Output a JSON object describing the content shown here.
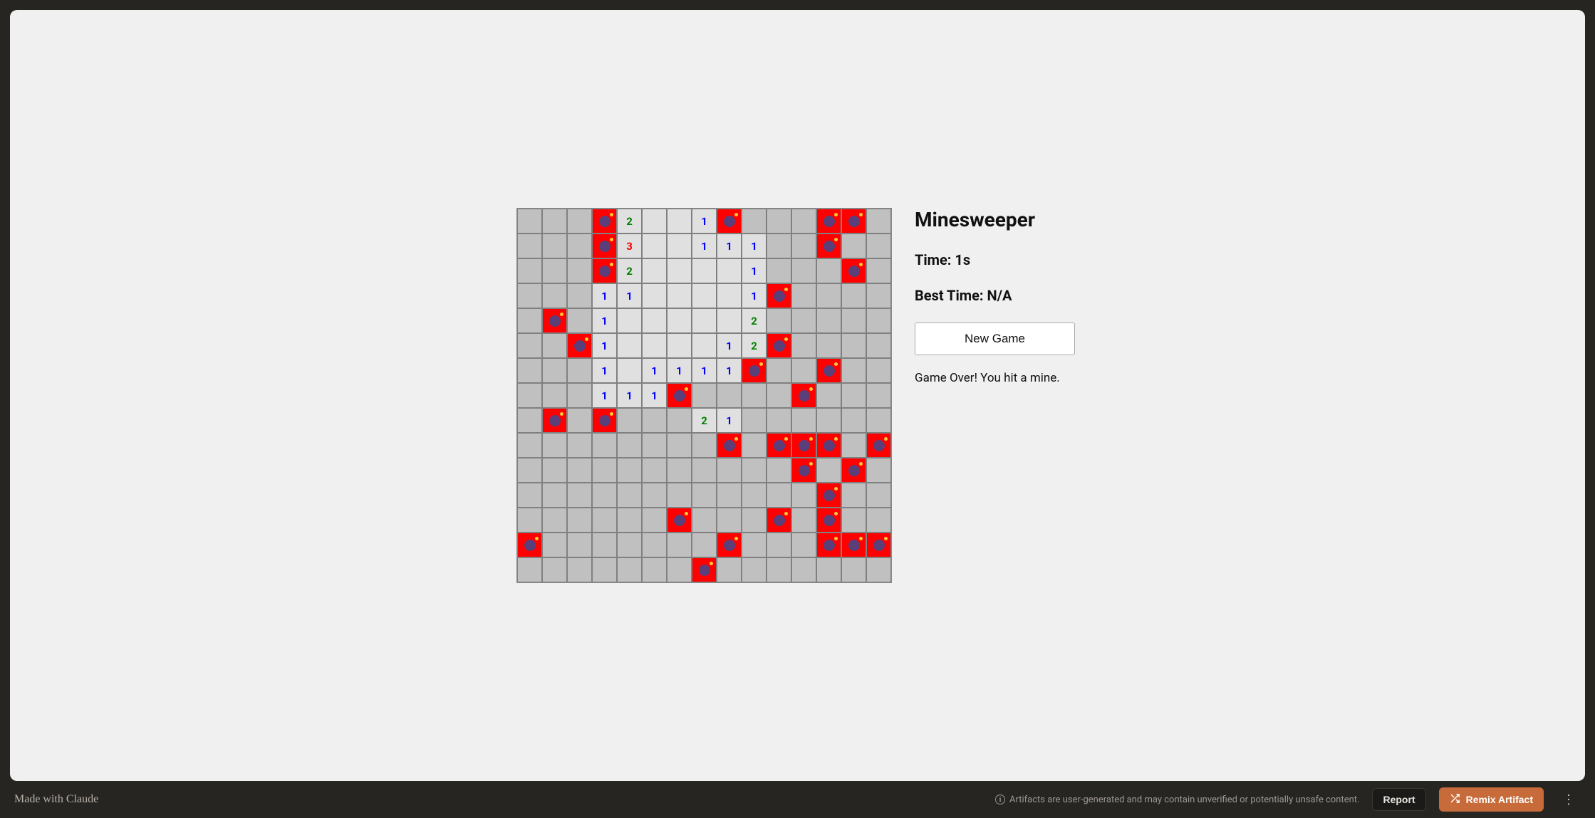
{
  "game": {
    "title": "Minesweeper",
    "time_label": "Time: ",
    "time_value": "1s",
    "best_label": "Best Time: ",
    "best_value": "N/A",
    "new_game_label": "New Game",
    "status_message": "Game Over! You hit a mine.",
    "grid_size": 15,
    "cells": [
      [
        "c",
        "c",
        "c",
        "m",
        "2",
        "o",
        "o",
        "1",
        "m",
        "c",
        "c",
        "c",
        "m",
        "m",
        "c"
      ],
      [
        "c",
        "c",
        "c",
        "m",
        "3",
        "o",
        "o",
        "1",
        "1",
        "1",
        "c",
        "c",
        "m",
        "c",
        "c"
      ],
      [
        "c",
        "c",
        "c",
        "m",
        "2",
        "o",
        "o",
        "o",
        "o",
        "1",
        "c",
        "c",
        "c",
        "m",
        "c"
      ],
      [
        "c",
        "c",
        "c",
        "1",
        "1",
        "o",
        "o",
        "o",
        "o",
        "1",
        "m",
        "c",
        "c",
        "c",
        "c"
      ],
      [
        "c",
        "m",
        "c",
        "1",
        "o",
        "o",
        "o",
        "o",
        "o",
        "2",
        "c",
        "c",
        "c",
        "c",
        "c"
      ],
      [
        "c",
        "c",
        "m",
        "1",
        "o",
        "o",
        "o",
        "o",
        "1",
        "2",
        "m",
        "c",
        "c",
        "c",
        "c"
      ],
      [
        "c",
        "c",
        "c",
        "1",
        "o",
        "1",
        "1",
        "1",
        "1",
        "m",
        "c",
        "c",
        "m",
        "c",
        "c"
      ],
      [
        "c",
        "c",
        "c",
        "1",
        "1",
        "1",
        "m",
        "c",
        "c",
        "c",
        "c",
        "m",
        "c",
        "c",
        "c"
      ],
      [
        "c",
        "m",
        "c",
        "m",
        "c",
        "c",
        "c",
        "2",
        "1",
        "c",
        "c",
        "c",
        "c",
        "c",
        "c"
      ],
      [
        "c",
        "c",
        "c",
        "c",
        "c",
        "c",
        "c",
        "c",
        "m",
        "c",
        "m",
        "m",
        "m",
        "c",
        "m"
      ],
      [
        "c",
        "c",
        "c",
        "c",
        "c",
        "c",
        "c",
        "c",
        "c",
        "c",
        "c",
        "m",
        "c",
        "m",
        "c"
      ],
      [
        "c",
        "c",
        "c",
        "c",
        "c",
        "c",
        "c",
        "c",
        "c",
        "c",
        "c",
        "c",
        "m",
        "c",
        "c"
      ],
      [
        "c",
        "c",
        "c",
        "c",
        "c",
        "c",
        "m",
        "c",
        "c",
        "c",
        "m",
        "c",
        "m",
        "c",
        "c"
      ],
      [
        "m",
        "c",
        "c",
        "c",
        "c",
        "c",
        "c",
        "c",
        "m",
        "c",
        "c",
        "c",
        "m",
        "m",
        "m"
      ],
      [
        "c",
        "c",
        "c",
        "c",
        "c",
        "c",
        "c",
        "m",
        "c",
        "c",
        "c",
        "c",
        "c",
        "c",
        "c"
      ]
    ]
  },
  "footer": {
    "made_with_prefix": "Made with ",
    "made_with_brand": "Claude",
    "disclaimer": "Artifacts are user-generated and may contain unverified or potentially unsafe content.",
    "report_label": "Report",
    "remix_label": "Remix Artifact"
  }
}
